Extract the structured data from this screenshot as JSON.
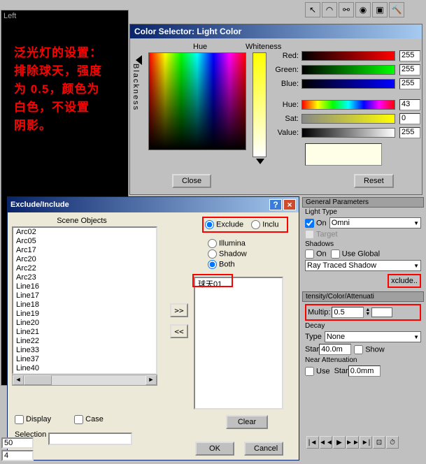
{
  "viewport": {
    "label": "Left"
  },
  "annotation": "泛光灯的设置：\n排除球天，强度\n为 0.5，颜色为\n白色，不设置\n阴影。",
  "color_selector": {
    "title": "Color Selector: Light Color",
    "hue": "Hue",
    "whiteness": "Whiteness",
    "blackness": "Blackness",
    "red": "Red:",
    "green": "Green:",
    "blue": "Blue:",
    "hue_l": "Hue:",
    "sat": "Sat:",
    "val": "Value:",
    "r": "255",
    "g": "255",
    "b": "255",
    "h": "43",
    "s": "0",
    "v": "255",
    "close": "Close",
    "reset": "Reset"
  },
  "exclude": {
    "title": "Exclude/Include",
    "scene_objects": "Scene Objects",
    "items": [
      "Arc02",
      "Arc05",
      "Arc17",
      "Arc20",
      "Arc22",
      "Arc23",
      "Line16",
      "Line17",
      "Line18",
      "Line19",
      "Line20",
      "Line21",
      "Line22",
      "Line33",
      "Line37",
      "Line40"
    ],
    "exclude": "Exclude",
    "include": "Inclu",
    "illum": "Illumina",
    "shadow": "Shadow",
    "both": "Both",
    "target": "球天01",
    "display": "Display",
    "case": "Case",
    "selsets": "Selection\nSets",
    "clear": "Clear",
    "ok": "OK",
    "cancel": "Cancel",
    "arrow_r": ">>",
    "arrow_l": "<<"
  },
  "panels": {
    "gen_params": "General Parameters",
    "light_type": "Light Type",
    "on": "On",
    "omni": "Omni",
    "target": "Target",
    "shadows": "Shadows",
    "use_global": "Use Global",
    "ray_traced": "Ray Traced Shadow",
    "exclude_btn": "xclude..",
    "intensity": "tensity/Color/Attenuati",
    "multip": "Multip:",
    "multip_val": "0.5",
    "decay": "Decay",
    "type": "Type",
    "none": "None",
    "start": "Star",
    "start_val": "40.0m",
    "show": "Show",
    "near_att": "Near Attenuation",
    "use": "Use",
    "near_val": "0.0mm"
  },
  "bottom": {
    "v1": "50",
    "v2": "4"
  }
}
